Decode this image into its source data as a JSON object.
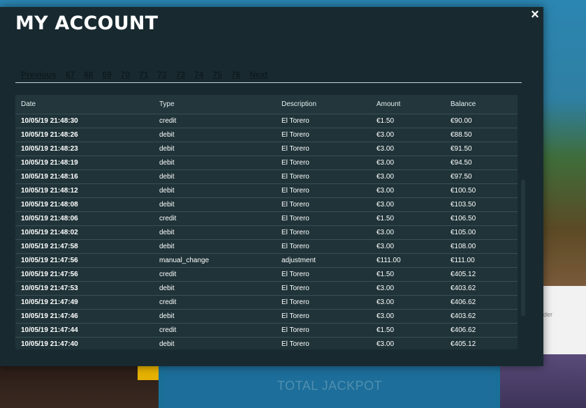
{
  "background": {
    "jackpot_label": "TOTAL JACKPOT",
    "side_text": "der"
  },
  "modal": {
    "title": "MY ACCOUNT",
    "close_label": "×"
  },
  "pagination": {
    "previous": "Previous",
    "pages": [
      "67",
      "68",
      "69",
      "70",
      "71",
      "72",
      "73",
      "74",
      "75",
      "76"
    ],
    "next": "Next"
  },
  "table": {
    "headers": [
      "Date",
      "Type",
      "Description",
      "Amount",
      "Balance"
    ],
    "rows": [
      [
        "10/05/19 21:48:30",
        "credit",
        "El Torero",
        "€1.50",
        "€90.00"
      ],
      [
        "10/05/19 21:48:26",
        "debit",
        "El Torero",
        "€3.00",
        "€88.50"
      ],
      [
        "10/05/19 21:48:23",
        "debit",
        "El Torero",
        "€3.00",
        "€91.50"
      ],
      [
        "10/05/19 21:48:19",
        "debit",
        "El Torero",
        "€3.00",
        "€94.50"
      ],
      [
        "10/05/19 21:48:16",
        "debit",
        "El Torero",
        "€3.00",
        "€97.50"
      ],
      [
        "10/05/19 21:48:12",
        "debit",
        "El Torero",
        "€3.00",
        "€100.50"
      ],
      [
        "10/05/19 21:48:08",
        "debit",
        "El Torero",
        "€3.00",
        "€103.50"
      ],
      [
        "10/05/19 21:48:06",
        "credit",
        "El Torero",
        "€1.50",
        "€106.50"
      ],
      [
        "10/05/19 21:48:02",
        "debit",
        "El Torero",
        "€3.00",
        "€105.00"
      ],
      [
        "10/05/19 21:47:58",
        "debit",
        "El Torero",
        "€3.00",
        "€108.00"
      ],
      [
        "10/05/19 21:47:56",
        "manual_change",
        "adjustment",
        "€111.00",
        "€111.00"
      ],
      [
        "10/05/19 21:47:56",
        "credit",
        "El Torero",
        "€1.50",
        "€405.12"
      ],
      [
        "10/05/19 21:47:53",
        "debit",
        "El Torero",
        "€3.00",
        "€403.62"
      ],
      [
        "10/05/19 21:47:49",
        "credit",
        "El Torero",
        "€3.00",
        "€406.62"
      ],
      [
        "10/05/19 21:47:46",
        "debit",
        "El Torero",
        "€3.00",
        "€403.62"
      ],
      [
        "10/05/19 21:47:44",
        "credit",
        "El Torero",
        "€1.50",
        "€406.62"
      ],
      [
        "10/05/19 21:47:40",
        "debit",
        "El Torero",
        "€3.00",
        "€405.12"
      ]
    ]
  }
}
